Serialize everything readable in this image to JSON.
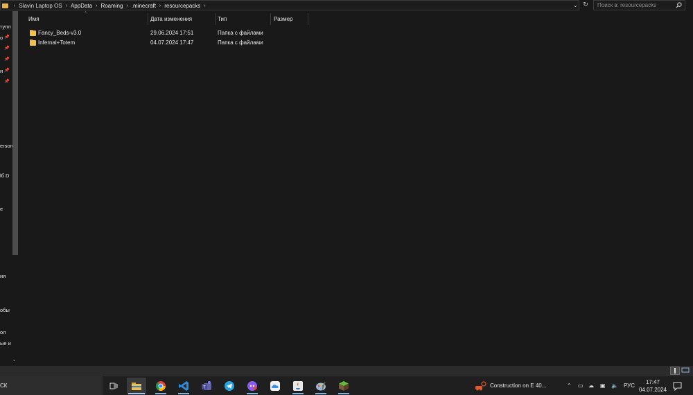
{
  "address_bar": {
    "overlap_label": "Slavin Laptop OS",
    "crumbs": [
      "AppData",
      "Roaming",
      ".minecraft",
      "resourcepacks"
    ],
    "dropdown_glyph": "⌄",
    "refresh_glyph": "↻"
  },
  "search": {
    "placeholder": "Поиск в: resourcepacks",
    "icon": "search-icon"
  },
  "nav_pane": {
    "items": [
      {
        "label": "тупл",
        "pinned": false
      },
      {
        "label": "о",
        "pinned": true
      },
      {
        "label": "",
        "pinned": true
      },
      {
        "label": "",
        "pinned": true
      },
      {
        "label": "и",
        "pinned": true
      },
      {
        "label": "",
        "pinned": true
      },
      {
        "label": "erson",
        "pinned": false
      },
      {
        "label": "lб D",
        "pinned": false
      },
      {
        "label": "e",
        "pinned": false
      },
      {
        "label": "ия",
        "pinned": false
      },
      {
        "label": "обы",
        "pinned": false
      },
      {
        "label": "ол",
        "pinned": false
      },
      {
        "label": "ые и",
        "pinned": false
      }
    ]
  },
  "columns": [
    {
      "label": "Имя"
    },
    {
      "label": "Дата изменения"
    },
    {
      "label": "Тип"
    },
    {
      "label": "Размер"
    }
  ],
  "files": [
    {
      "name": "Fancy_Beds-v3.0",
      "date": "29.06.2024 17:51",
      "type": "Папка с файлами",
      "size": ""
    },
    {
      "name": "Infernal+Totem",
      "date": "04.07.2024 17:47",
      "type": "Папка с файлами",
      "size": ""
    }
  ],
  "taskbar": {
    "search_text": "СК",
    "apps": [
      {
        "name": "task-view-icon",
        "active": false,
        "running": false
      },
      {
        "name": "file-explorer-icon",
        "active": true,
        "running": true
      },
      {
        "name": "chrome-icon",
        "active": false,
        "running": true
      },
      {
        "name": "vscode-icon",
        "active": false,
        "running": true
      },
      {
        "name": "teams-icon",
        "active": false,
        "running": false
      },
      {
        "name": "telegram-icon",
        "active": false,
        "running": false
      },
      {
        "name": "discord-icon",
        "active": false,
        "running": true
      },
      {
        "name": "icloud-icon",
        "active": false,
        "running": false
      },
      {
        "name": "java-icon",
        "active": false,
        "running": true
      },
      {
        "name": "paint-icon",
        "active": false,
        "running": true
      },
      {
        "name": "minecraft-icon",
        "active": false,
        "running": true
      }
    ],
    "notification_text": "Construction on E 40...",
    "lang": "РУС",
    "time": "17:47",
    "date": "04.07.2024"
  }
}
